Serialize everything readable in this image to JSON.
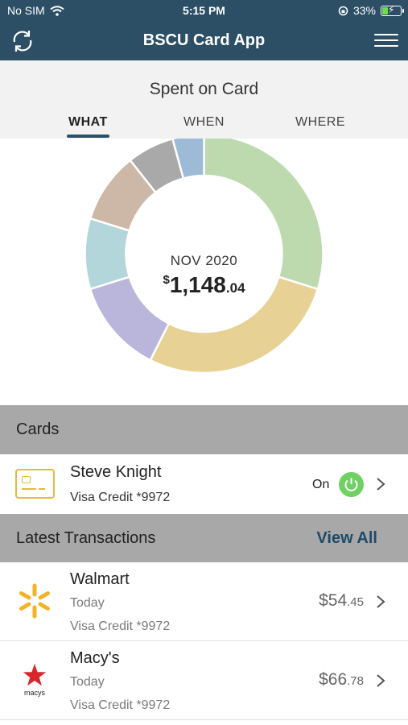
{
  "status_bar": {
    "carrier": "No SIM",
    "time": "5:15 PM",
    "battery_percent": "33%",
    "battery_level": 0.33
  },
  "nav": {
    "title": "BSCU Card App",
    "refresh_icon": "refresh-icon",
    "menu_icon": "hamburger-menu-icon"
  },
  "spent": {
    "title": "Spent on Card",
    "tabs": [
      {
        "label": "WHAT",
        "active": true
      },
      {
        "label": "WHEN",
        "active": false
      },
      {
        "label": "WHERE",
        "active": false
      }
    ],
    "month": "NOV 2020",
    "amount_symbol": "$",
    "amount_dollars": "1,148",
    "amount_cents": ".04"
  },
  "chart_data": {
    "type": "pie",
    "title": "",
    "total_label": "$1,148.04",
    "slices": [
      {
        "value": 28.0,
        "color": "#bcdaae"
      },
      {
        "value": 26.0,
        "color": "#e8d195"
      },
      {
        "value": 12.0,
        "color": "#b9b5db"
      },
      {
        "value": 9.0,
        "color": "#b2d6da"
      },
      {
        "value": 9.0,
        "color": "#cdb8a8"
      },
      {
        "value": 6.0,
        "color": "#a9a9a9"
      },
      {
        "value": 4.0,
        "color": "#9dbad6"
      }
    ]
  },
  "cards": {
    "section_label": "Cards",
    "items": [
      {
        "name": "Steve Knight",
        "detail": "Visa Credit *9972",
        "status": "On"
      }
    ]
  },
  "transactions": {
    "section_label": "Latest Transactions",
    "view_all": "View All",
    "items": [
      {
        "merchant": "Walmart",
        "date": "Today",
        "card": "Visa Credit *9972",
        "amount_dollars": "$54",
        "amount_cents": ".45",
        "logo": "walmart-logo"
      },
      {
        "merchant": "Macy's",
        "date": "Today",
        "card": "Visa Credit *9972",
        "amount_dollars": "$66",
        "amount_cents": ".78",
        "logo": "macys-logo",
        "logo_text": "macys"
      }
    ]
  }
}
